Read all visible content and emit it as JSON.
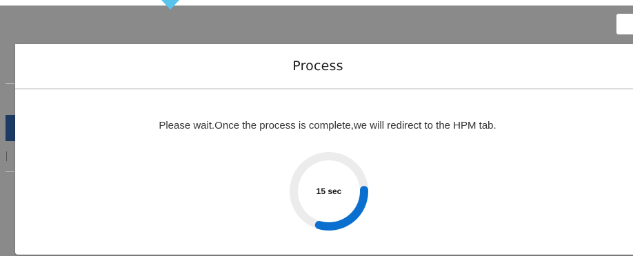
{
  "modal": {
    "title": "Process",
    "message": "Please wait.Once the process is complete,we will redirect to the HPM tab."
  },
  "timer": {
    "label": "15 sec",
    "progress_fraction": 0.3,
    "track_color": "#ececec",
    "progress_color": "#0a6fce"
  },
  "background": {
    "topbar_color": "#8a8a8a",
    "accent_color": "#58c4ee",
    "nav_color": "#1d3a63"
  }
}
